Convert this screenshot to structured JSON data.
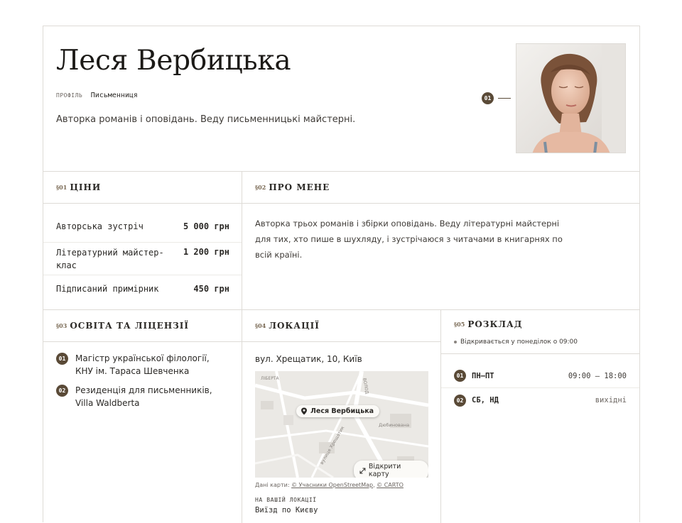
{
  "header": {
    "name": "Леся Вербицька",
    "meta_key": "ПРОФІЛЬ",
    "meta_value": "Письменниця",
    "tagline": "Авторка романів і оповідань. Веду письменницькі майстерні.",
    "photo_index": "01"
  },
  "prices": {
    "num": "§01",
    "title": "ЦІНИ",
    "items": [
      {
        "label": "Авторська зустріч",
        "value": "5 000 грн"
      },
      {
        "label": "Літературний майстер-клас",
        "value": "1 200 грн"
      },
      {
        "label": "Підписаний примірник",
        "value": "450 грн"
      }
    ]
  },
  "about": {
    "num": "§02",
    "title": "ПРО МЕНЕ",
    "text": "Авторка трьох романів і збірки оповідань. Веду літературні майстерні для тих, хто пише в шухляду, і зустрічаюся з читачами в книгарнях по всій країні."
  },
  "education": {
    "num": "§03",
    "title": "ОСВІТА ТА ЛІЦЕНЗІЇ",
    "items": [
      {
        "index": "01",
        "text": "Магістр української філології, КНУ ім. Тараса Шевченка"
      },
      {
        "index": "02",
        "text": "Резиденція для письменників, Villa Waldberta"
      }
    ]
  },
  "locations": {
    "num": "§04",
    "title": "ЛОКАЦІЇ",
    "address": "вул. Хрещатик, 10, Київ",
    "map_pin": "Леся Вербицька",
    "open_map_label": "Відкрити карту",
    "attribution_prefix": "Дані карти:",
    "attribution_osm": "© Учасники OpenStreetMap",
    "attribution_carto": "© CARTO",
    "map_labels": [
      "вулиця Хрещатик",
      "Дюбинована",
      "БЕРНЕЦЬКА ГОРА",
      "ВОЛОД",
      "ЛІБЕРТА"
    ],
    "near_key": "НА ВАШІЙ ЛОКАЦІЇ",
    "near_value": "Виїзд по Києву"
  },
  "schedule": {
    "num": "§05",
    "title": "РОЗКЛАД",
    "status": "Відкривається у понеділок о 09:00",
    "rows": [
      {
        "index": "01",
        "day": "ПН–ПТ",
        "time": "09:00 — 18:00"
      },
      {
        "index": "02",
        "day": "СБ, НД",
        "time": "вихідні"
      }
    ]
  }
}
